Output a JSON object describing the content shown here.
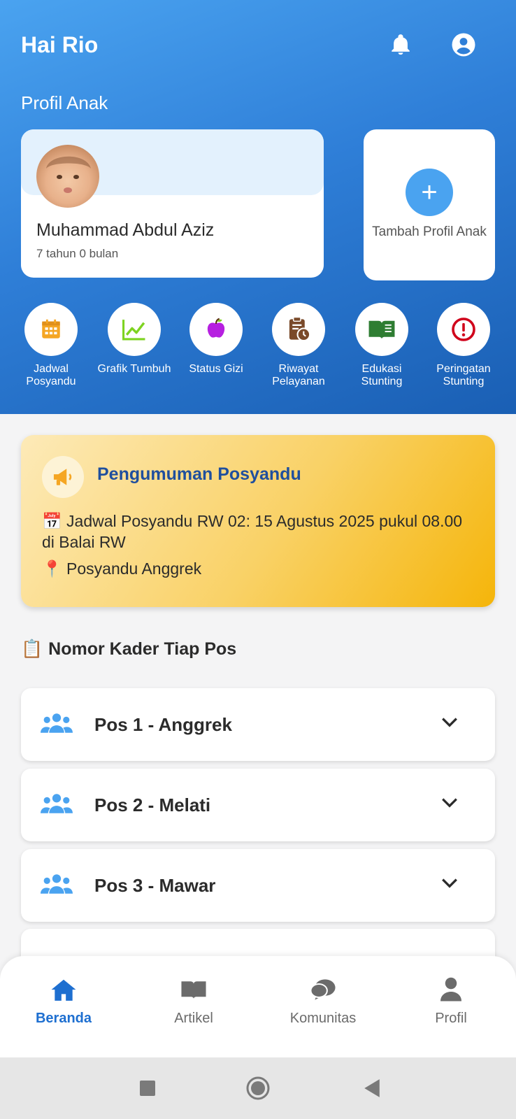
{
  "header": {
    "greeting": "Hai Rio",
    "section_label": "Profil Anak",
    "icons": [
      "bell-icon",
      "account-circle-icon"
    ]
  },
  "child_profile": {
    "name": "Muhammad Abdul Aziz",
    "age": "7 tahun 0 bulan"
  },
  "add_profile": {
    "label": "Tambah Profil Anak",
    "icon": "plus-icon"
  },
  "menu": [
    {
      "label": "Jadwal Posyandu",
      "icon": "calendar-icon",
      "color": "#f5a623"
    },
    {
      "label": "Grafik Tumbuh",
      "icon": "line-chart-icon",
      "color": "#7ed321"
    },
    {
      "label": "Status Gizi",
      "icon": "apple-icon",
      "color": "#b620e0"
    },
    {
      "label": "Riwayat Pelayanan",
      "icon": "clipboard-clock-icon",
      "color": "#7a4a2a"
    },
    {
      "label": "Edukasi Stunting",
      "icon": "book-open-icon",
      "color": "#2e7d32"
    },
    {
      "label": "Peringatan Stunting",
      "icon": "alert-circle-icon",
      "color": "#d0021b"
    }
  ],
  "announcement": {
    "title": "Pengumuman Posyandu",
    "text": "📅 Jadwal Posyandu RW 02: 15 Agustus 2025 pukul 08.00 di Balai RW",
    "location": "📍 Posyandu Anggrek",
    "icon": "megaphone-icon"
  },
  "kader": {
    "title": "Nomor Kader Tiap Pos",
    "title_icon": "📋",
    "posts": [
      {
        "label": "Pos 1 - Anggrek"
      },
      {
        "label": "Pos 2 - Melati"
      },
      {
        "label": "Pos 3 - Mawar"
      }
    ]
  },
  "bottom_nav": [
    {
      "label": "Beranda",
      "icon": "home-icon",
      "active": true
    },
    {
      "label": "Artikel",
      "icon": "book-icon",
      "active": false
    },
    {
      "label": "Komunitas",
      "icon": "chat-bubbles-icon",
      "active": false
    },
    {
      "label": "Profil",
      "icon": "user-icon",
      "active": false
    }
  ],
  "colors": {
    "primary": "#2f7fd8",
    "accent_blue": "#4aa3f0",
    "announcement_title": "#1f4f9e",
    "nav_active": "#1e6fd0"
  }
}
